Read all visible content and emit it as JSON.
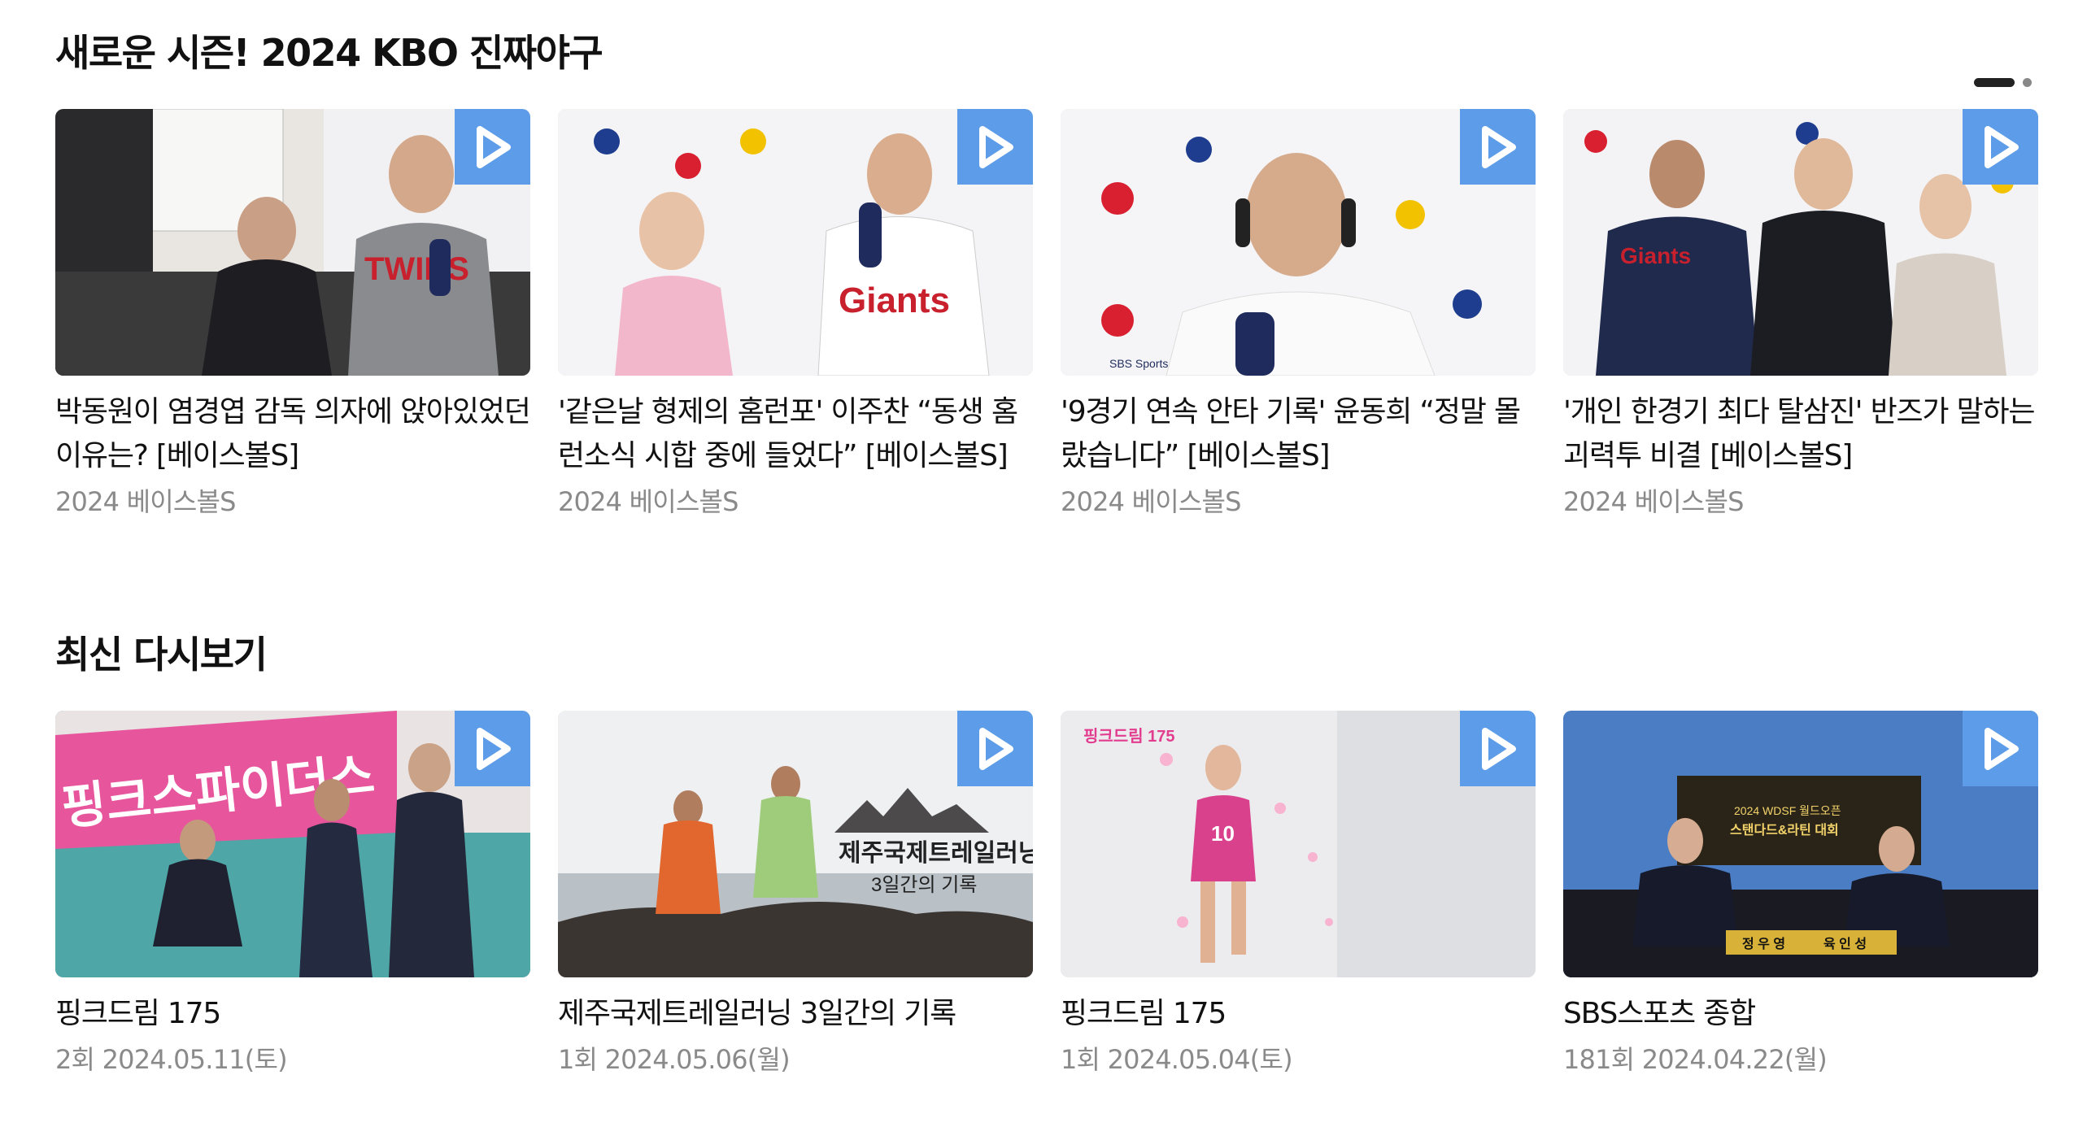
{
  "sections": [
    {
      "title": "새로운 시즌! 2024 KBO 진짜야구",
      "cards": [
        {
          "title": "박동원이 염경엽 감독 의자에 앉아있었던 이유는? [베이스볼S]",
          "sub": "2024 베이스볼S",
          "thumb_text": "TWINS"
        },
        {
          "title": "'같은날 형제의 홈런포' 이주찬 “동생 홈런소식 시합 중에 들었다” [베이스볼S]",
          "sub": "2024 베이스볼S",
          "thumb_text": "Giants"
        },
        {
          "title": "'9경기 연속 안타 기록' 윤동희 “정말 몰랐습니다” [베이스볼S]",
          "sub": "2024 베이스볼S",
          "thumb_text": "SBS Sports"
        },
        {
          "title": "'개인 한경기 최다 탈삼진' 반즈가 말하는 괴력투 비결 [베이스볼S]",
          "sub": "2024 베이스볼S",
          "thumb_text": "Giants"
        }
      ]
    },
    {
      "title": "최신 다시보기",
      "cards": [
        {
          "title": "핑크드림 175",
          "sub": "2회 2024.05.11(토)",
          "thumb_text": "핑크스파이더스"
        },
        {
          "title": "제주국제트레일러닝 3일간의 기록",
          "sub": "1회 2024.05.06(월)",
          "thumb_text": "제주국제트레일러닝",
          "thumb_text2": "3일간의 기록"
        },
        {
          "title": "핑크드림 175",
          "sub": "1회 2024.05.04(토)",
          "thumb_text": "핑크드림 175"
        },
        {
          "title": "SBS스포츠 종합",
          "sub": "181회 2024.04.22(월)",
          "thumb_text": "2024 WDSF 월드오픈",
          "thumb_text2": "스탠다드&라틴 대회",
          "thumb_name1": "정 우 영",
          "thumb_name2": "육 인 성"
        }
      ]
    }
  ],
  "colors": {
    "play_button": "#5c9ce8",
    "title": "#111111",
    "subtext": "#8a8a8a"
  }
}
